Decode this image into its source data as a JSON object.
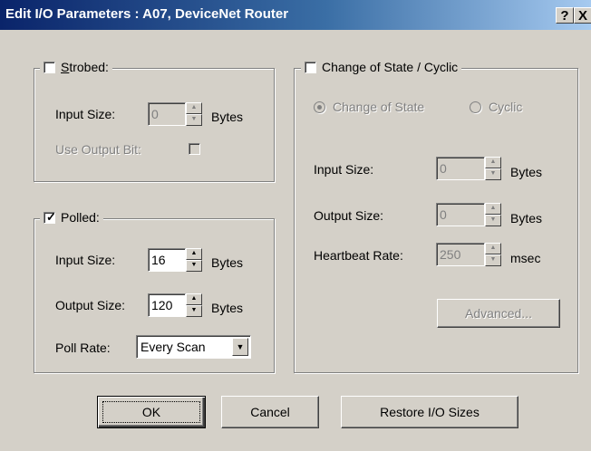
{
  "window": {
    "title": "Edit I/O Parameters : A07, DeviceNet Router",
    "help_label": "?",
    "close_label": "X"
  },
  "strobed": {
    "label": "Strobed:",
    "checked": false,
    "input_size_label": "Input Size:",
    "input_size_value": "0",
    "bytes_label": "Bytes",
    "use_output_bit_label": "Use Output Bit:"
  },
  "polled": {
    "label": "Polled:",
    "checked": true,
    "input_size_label": "Input Size:",
    "input_size_value": "16",
    "input_bytes_label": "Bytes",
    "output_size_label": "Output Size:",
    "output_size_value": "120",
    "output_bytes_label": "Bytes",
    "poll_rate_label": "Poll Rate:",
    "poll_rate_value": "Every Scan"
  },
  "cos": {
    "label": "Change of State / Cyclic",
    "checked": false,
    "radio_cos_label": "Change of State",
    "radio_cyclic_label": "Cyclic",
    "input_size_label": "Input Size:",
    "input_size_value": "0",
    "input_bytes_label": "Bytes",
    "output_size_label": "Output Size:",
    "output_size_value": "0",
    "output_bytes_label": "Bytes",
    "heartbeat_label": "Heartbeat Rate:",
    "heartbeat_value": "250",
    "heartbeat_unit": "msec",
    "advanced_label": "Advanced..."
  },
  "buttons": {
    "ok": "OK",
    "cancel": "Cancel",
    "restore": "Restore I/O Sizes"
  }
}
